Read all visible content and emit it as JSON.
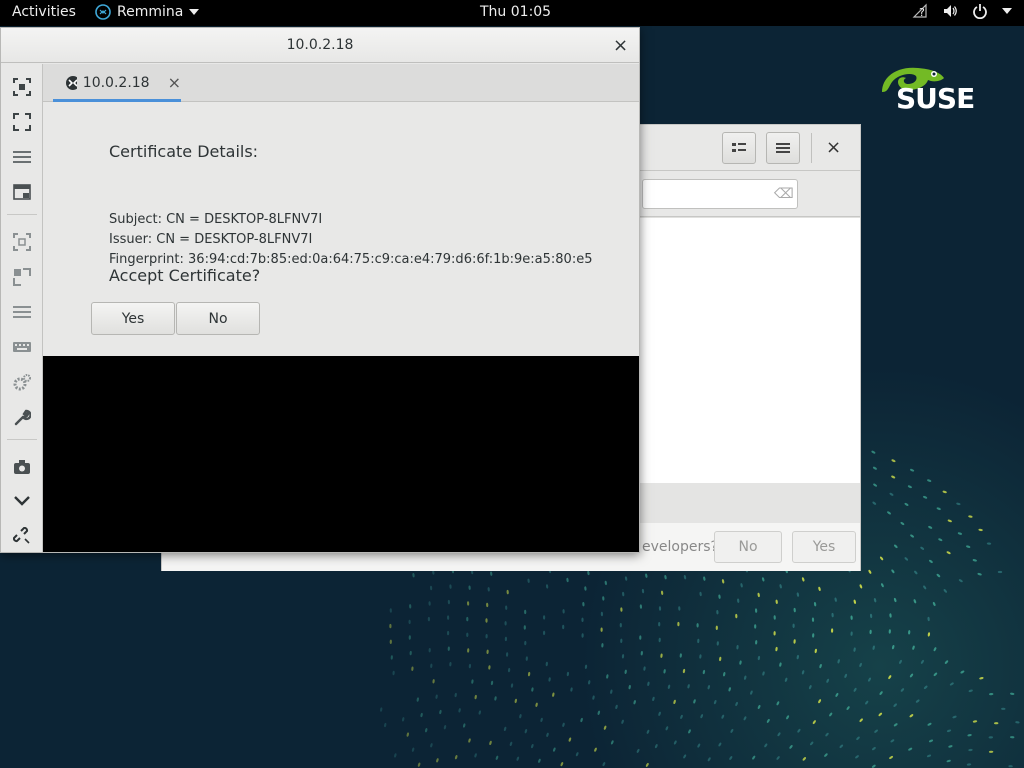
{
  "topbar": {
    "activities": "Activities",
    "app_name": "Remmina",
    "clock": "Thu 01:05"
  },
  "desktop": {
    "logo_text": "SUSE"
  },
  "bg_dialog": {
    "question_partial": "evelopers?",
    "no_label": "No",
    "yes_label": "Yes"
  },
  "remmina": {
    "window_title": "10.0.2.18",
    "tab_label": "10.0.2.18",
    "cert": {
      "heading": "Certificate Details:",
      "subject": "Subject: CN = DESKTOP-8LFNV7I",
      "issuer": "Issuer: CN = DESKTOP-8LFNV7I",
      "fingerprint": "Fingerprint: 36:94:cd:7b:85:ed:0a:64:75:c9:ca:e4:79:d6:6f:1b:9e:a5:80:e5",
      "question": "Accept Certificate?",
      "yes_label": "Yes",
      "no_label": "No"
    }
  },
  "colors": {
    "desktop_bg": "#0c2435",
    "suse_green": "#73ba25",
    "tab_accent": "#4a90d9"
  }
}
